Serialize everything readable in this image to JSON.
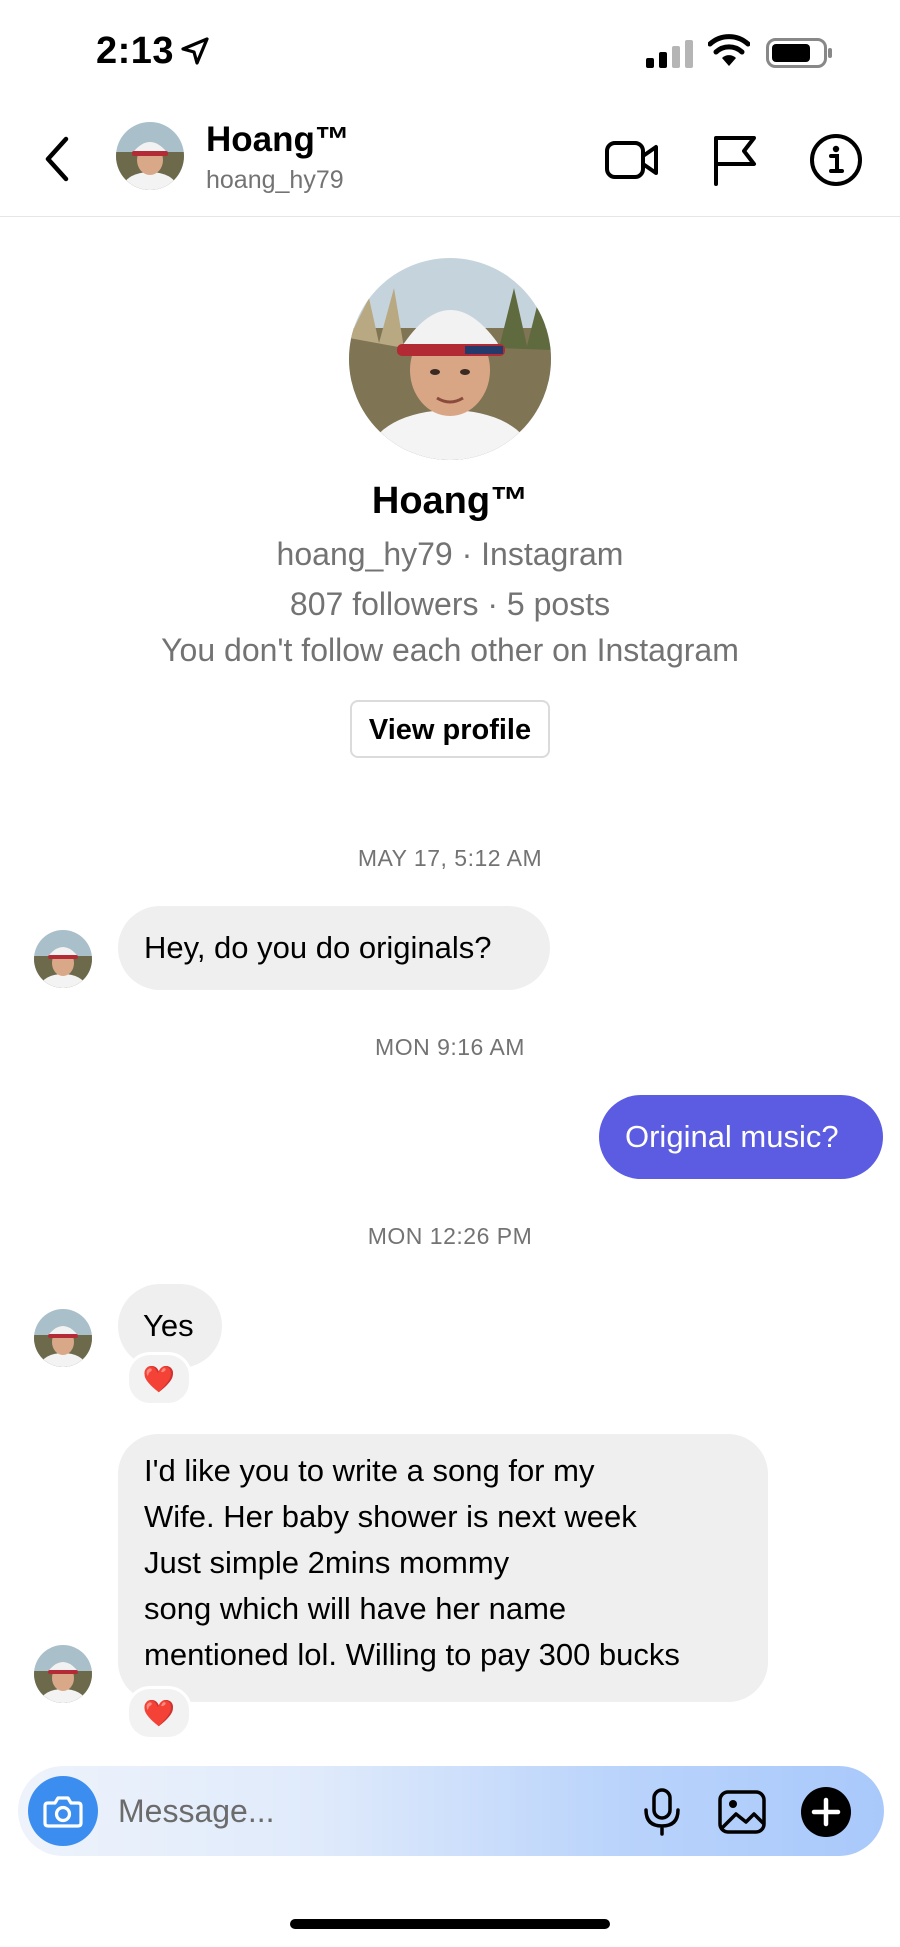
{
  "status_bar": {
    "time": "2:13",
    "icons": [
      "location-arrow-icon",
      "cellular-signal-icon",
      "wifi-icon",
      "battery-icon"
    ]
  },
  "header": {
    "display_name": "Hoang™",
    "username": "hoang_hy79",
    "icons": [
      "back-chevron-icon",
      "video-camera-icon",
      "flag-icon",
      "info-icon"
    ]
  },
  "profile": {
    "display_name": "Hoang™",
    "username_line": "hoang_hy79 · Instagram",
    "stats_line": "807 followers · 5 posts",
    "relation_line": "You don't follow each other on Instagram",
    "view_profile_label": "View profile"
  },
  "messages": [
    {
      "timestamp": "MAY 17, 5:12 AM"
    },
    {
      "from": "them",
      "text": "Hey, do you do originals?"
    },
    {
      "timestamp": "MON 9:16 AM"
    },
    {
      "from": "me",
      "text": "Original music?"
    },
    {
      "timestamp": "MON 12:26 PM"
    },
    {
      "from": "them",
      "text": "Yes",
      "reaction": "❤️"
    },
    {
      "from": "them",
      "lines": [
        "I'd like you to write a song for my",
        "Wife. Her baby shower is next week",
        "Just simple 2mins mommy",
        "song which will have her name",
        "mentioned lol. Willing to pay 300 bucks"
      ],
      "reaction": "❤️"
    }
  ],
  "composer": {
    "placeholder": "Message...",
    "icons": [
      "camera-icon",
      "microphone-icon",
      "gallery-icon",
      "add-icon"
    ]
  },
  "colors": {
    "sent_bubble": "#5b5ce2",
    "received_bubble": "#efefef",
    "camera_button": "#3b8ef0",
    "secondary_text": "#737373"
  }
}
